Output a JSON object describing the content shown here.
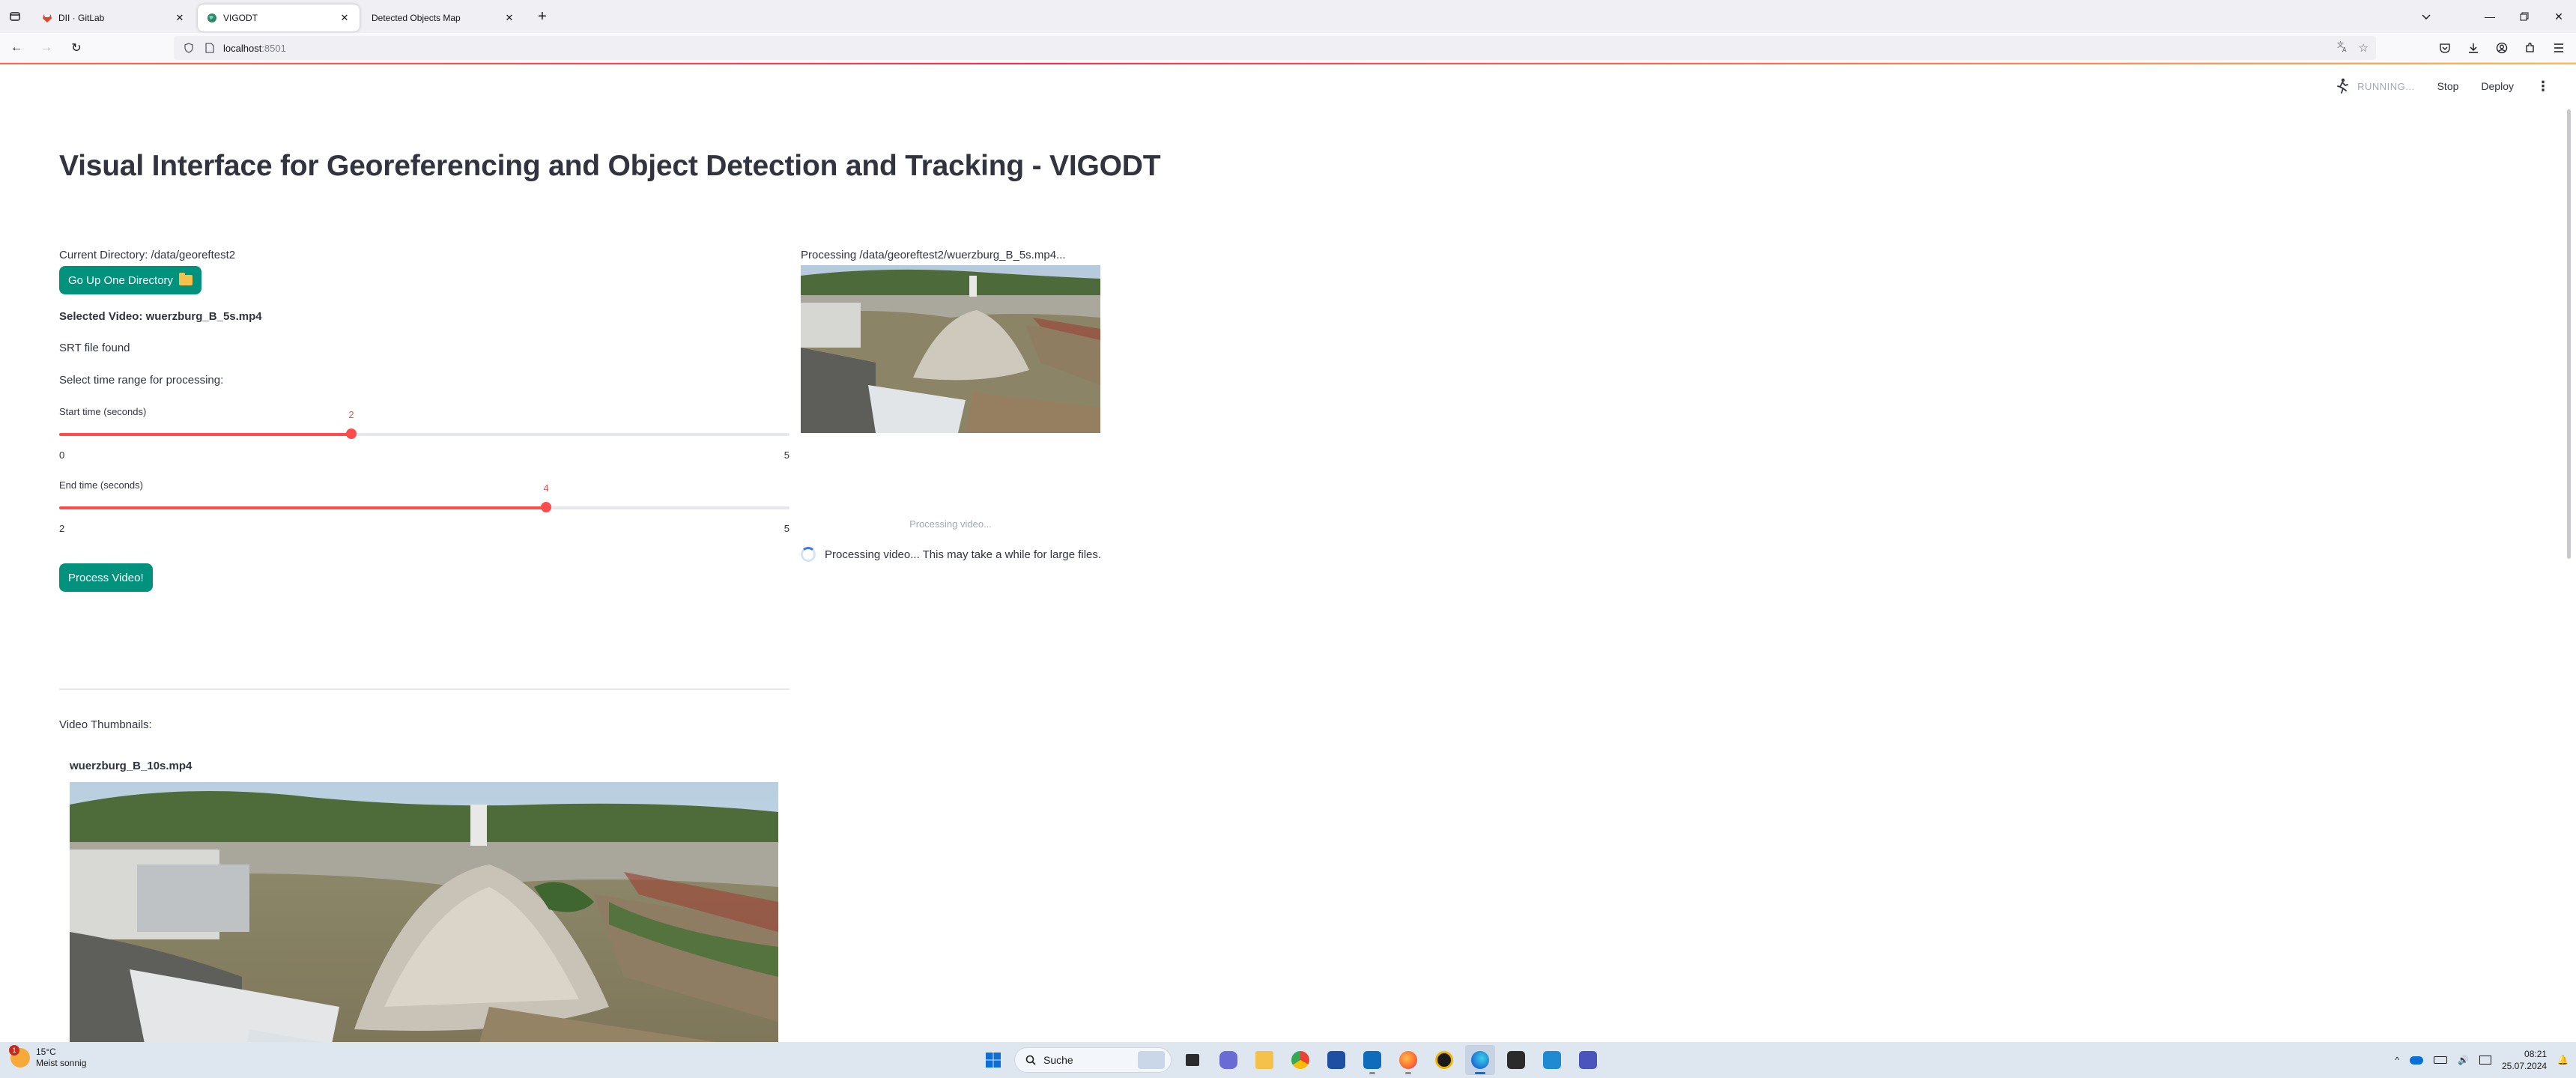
{
  "browser": {
    "tabs": [
      {
        "title": "DII · GitLab",
        "active": false,
        "favicon_color": "#e24329"
      },
      {
        "title": "VIGODT",
        "active": true,
        "favicon_color": "#3a9d5d"
      },
      {
        "title": "Detected Objects Map",
        "active": false,
        "favicon_color": ""
      }
    ],
    "url_host": "localhost",
    "url_port": ":8501"
  },
  "app": {
    "status": "RUNNING...",
    "stop_label": "Stop",
    "deploy_label": "Deploy",
    "title": "Visual Interface for Georeferencing and Object Detection and Tracking - VIGODT",
    "current_directory": "Current Directory: /data/georeftest2",
    "go_up_label": "Go Up One Directory",
    "selected_video": "Selected Video: wuerzburg_B_5s.mp4",
    "srt_status": "SRT file found",
    "time_range_prompt": "Select time range for processing:",
    "start_slider": {
      "label": "Start time (seconds)",
      "value": 2,
      "min": 0,
      "max": 5
    },
    "end_slider": {
      "label": "End time (seconds)",
      "value": 4,
      "min": 2,
      "max": 5
    },
    "process_label": "Process Video!",
    "thumbnails_label": "Video Thumbnails:",
    "thumbnail_title": "wuerzburg_B_10s.mp4",
    "processing_path": "Processing /data/georeftest2/wuerzburg_B_5s.mp4...",
    "preview_caption": "Processing video...",
    "spinner_text": "Processing video... This may take a while for large files.",
    "accent_color": "#00927d",
    "slider_color": "#ff4b4b"
  },
  "taskbar": {
    "temperature": "15°C",
    "weather": "Meist sonnig",
    "weather_badge": "1",
    "search_placeholder": "Suche",
    "time": "08:21",
    "date": "25.07.2024"
  }
}
